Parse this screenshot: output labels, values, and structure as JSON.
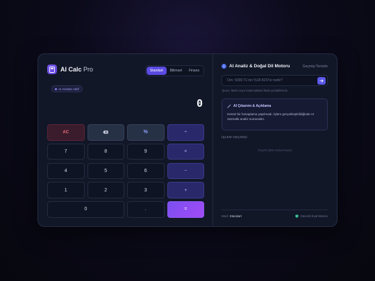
{
  "app": {
    "title": "AI Calc",
    "title_suffix": "Pro"
  },
  "modes": [
    {
      "label": "Standart",
      "active": true
    },
    {
      "label": "Bilimsel",
      "active": false
    },
    {
      "label": "Finans",
      "active": false
    }
  ],
  "badge": {
    "label": "AI Asistan Aktif"
  },
  "display": {
    "value": "0"
  },
  "keys": {
    "ac": "AC",
    "percent": "%",
    "divide": "÷",
    "seven": "7",
    "eight": "8",
    "nine": "9",
    "multiply": "×",
    "four": "4",
    "five": "5",
    "six": "6",
    "minus": "−",
    "one": "1",
    "two": "2",
    "three": "3",
    "plus": "+",
    "zero": "0",
    "decimal": ".",
    "equals": "="
  },
  "icons": {
    "backspace": "backspace-icon",
    "info": "info-icon",
    "wand": "wand-icon",
    "send": "arrow-right-icon",
    "shield": "shield-icon"
  },
  "ai_panel": {
    "title": "AI Analiz & Doğal Dil Motoru",
    "history_link": "Geçmişi Temizle",
    "input_placeholder": "Örn: 5000 TL'nin %18 KDV'si nedir?",
    "hint": "İpucu: Metin veya matematiksel ifade yazabilirsiniz.",
    "explain_title": "AI Çıkarımı & Açıklama",
    "explain_text": "Henüz bir hesaplama yapılmadı. İşlem gerçekleştirildiğinde AI otomatik analiz sunacaktır.",
    "history_label": "İŞLEM GEÇMİŞİ",
    "history_empty": "Kayıtlı işlem bulunmuyor",
    "mode_label": "Mod:",
    "mode_value": "Standart",
    "secure_label": "Güvenli Eval Motoru"
  },
  "colors": {
    "accent": "#5b4ae0",
    "equals_start": "#7a4ff0",
    "equals_end": "#a24bf5",
    "danger": "#f07080"
  }
}
